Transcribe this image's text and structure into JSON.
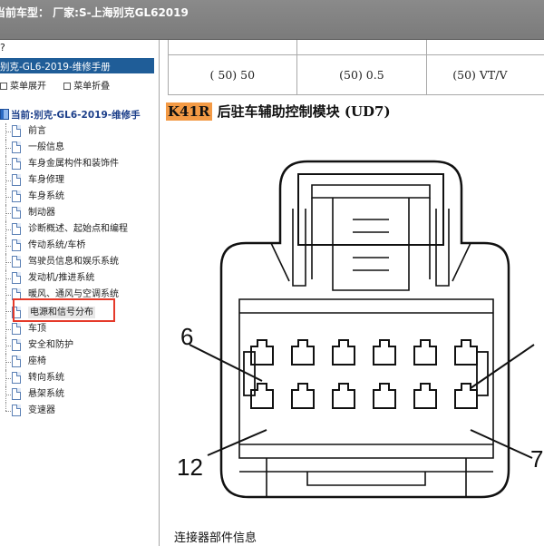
{
  "titlebar": {
    "title": "当前车型：  厂家:S-上海别克GL62019"
  },
  "sidebar": {
    "top_text": "?",
    "header": "别克-GL6-2019-维修手册",
    "tools": {
      "expand": "菜单展开",
      "collapse": "菜单折叠"
    },
    "root": "当前:别克-GL6-2019-维修手",
    "items": [
      {
        "label": "前言"
      },
      {
        "label": "一般信息"
      },
      {
        "label": "车身金属构件和装饰件"
      },
      {
        "label": "车身修理"
      },
      {
        "label": "车身系统"
      },
      {
        "label": "制动器"
      },
      {
        "label": "诊断概述、起始点和编程"
      },
      {
        "label": "传动系统/车桥"
      },
      {
        "label": "驾驶员信息和娱乐系统"
      },
      {
        "label": "发动机/推进系统"
      },
      {
        "label": "暖风、通风与空调系统"
      },
      {
        "label": "电源和信号分布"
      },
      {
        "label": "车顶"
      },
      {
        "label": "安全和防护"
      },
      {
        "label": "座椅"
      },
      {
        "label": "转向系统"
      },
      {
        "label": "悬架系统"
      },
      {
        "label": "变速器"
      }
    ],
    "highlight_color": "#e53a2a"
  },
  "content": {
    "table_values": [
      "( 50) 50",
      "(50) 0.5",
      "(50) VT/V"
    ],
    "heading_code": "K41R",
    "heading_text": "后驻车辅助控制模块 (UD7)",
    "code_color": "#f39a45",
    "connector": {
      "pin_labels": [
        "6",
        "12",
        "7"
      ]
    },
    "footer_label": "连接器部件信息"
  }
}
